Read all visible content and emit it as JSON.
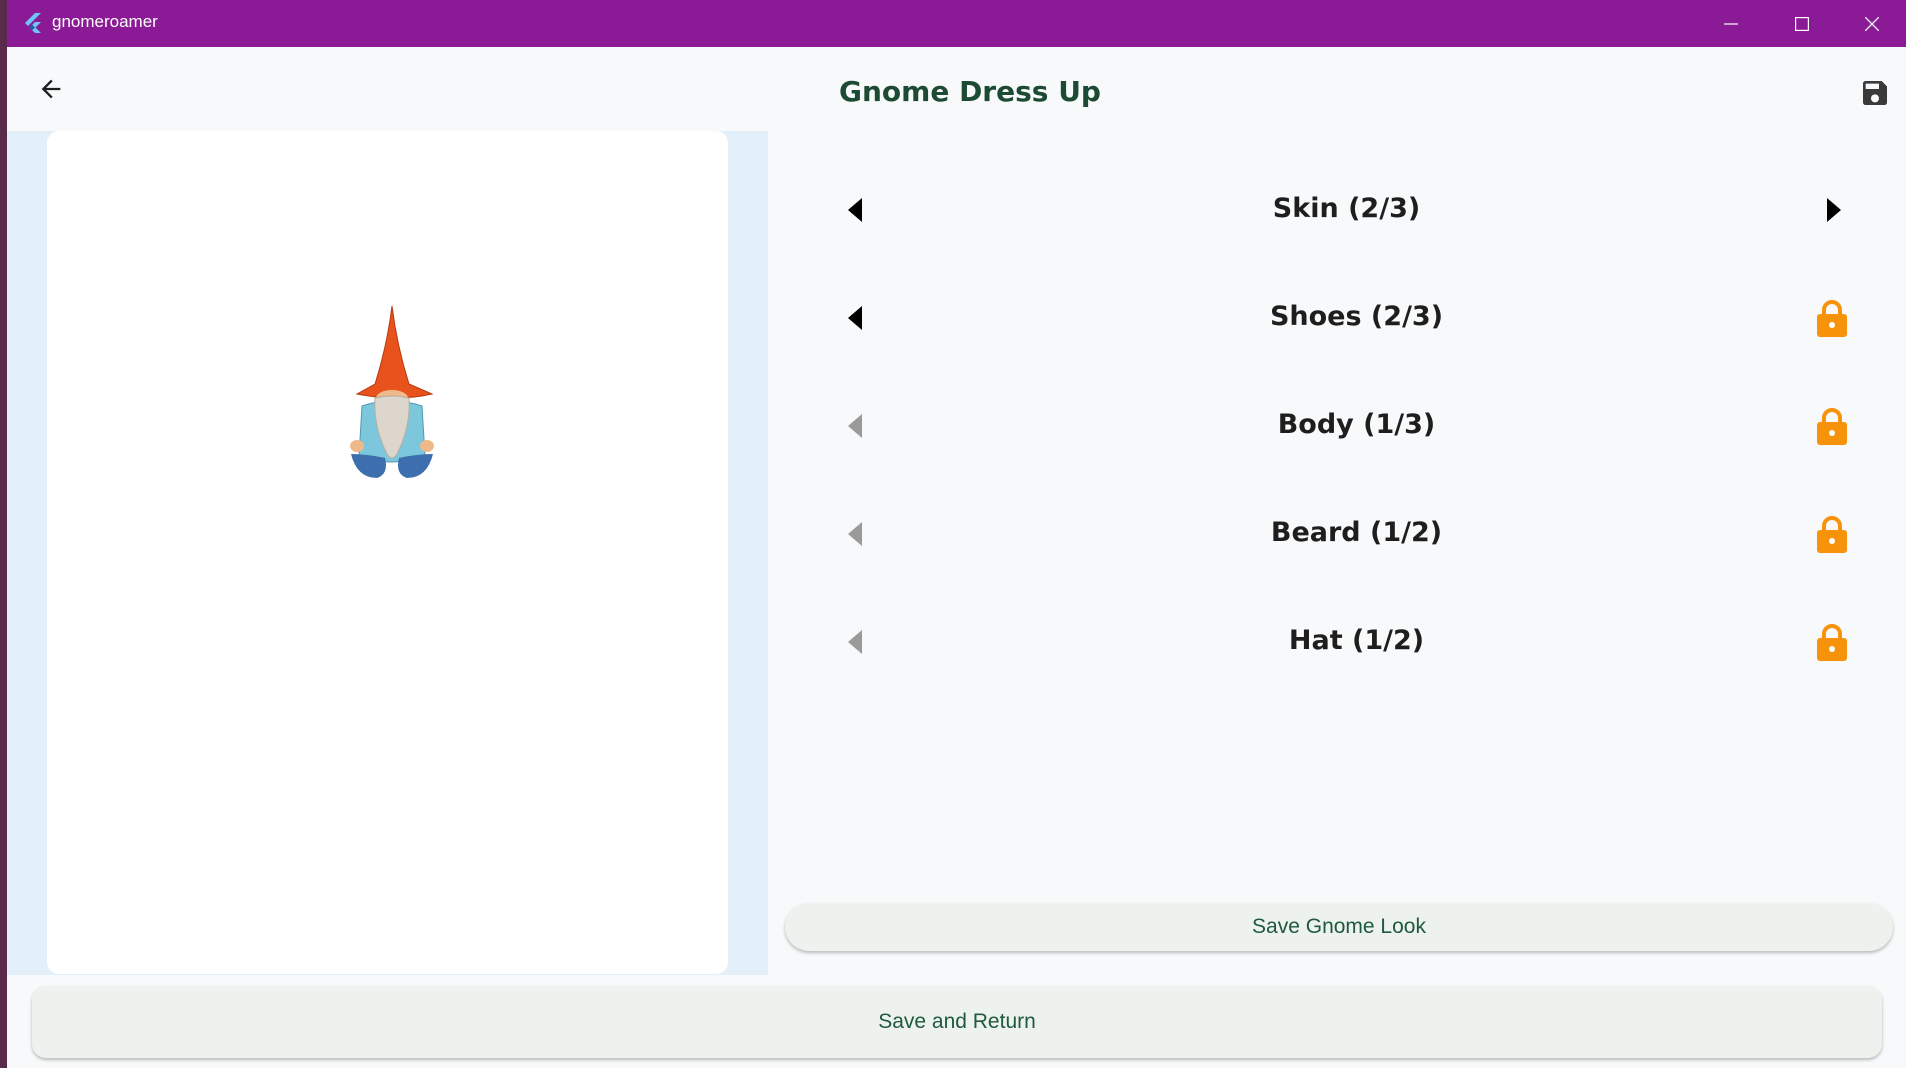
{
  "window": {
    "title": "gnomeroamer",
    "controls": [
      "minimize-icon",
      "maximize-icon",
      "close-icon"
    ]
  },
  "appbar": {
    "title": "Gnome Dress Up",
    "back_icon": "arrow-left-icon",
    "save_icon": "floppy-disk-icon"
  },
  "options": [
    {
      "label": "Skin (2/3)",
      "prev_enabled": true,
      "next": "arrow",
      "locked": false
    },
    {
      "label": "Shoes (2/3)",
      "prev_enabled": true,
      "next": "lock",
      "locked": true
    },
    {
      "label": "Body (1/3)",
      "prev_enabled": false,
      "next": "lock",
      "locked": true
    },
    {
      "label": "Beard (1/2)",
      "prev_enabled": false,
      "next": "lock",
      "locked": true
    },
    {
      "label": "Hat (1/2)",
      "prev_enabled": false,
      "next": "lock",
      "locked": true
    }
  ],
  "buttons": {
    "save_look": "Save Gnome Look",
    "save_return": "Save and Return"
  },
  "colors": {
    "titlebar": "#8a1a96",
    "title_text": "#1d4a33",
    "lock": "#f7930a",
    "preview_bg": "#e3eff9"
  }
}
